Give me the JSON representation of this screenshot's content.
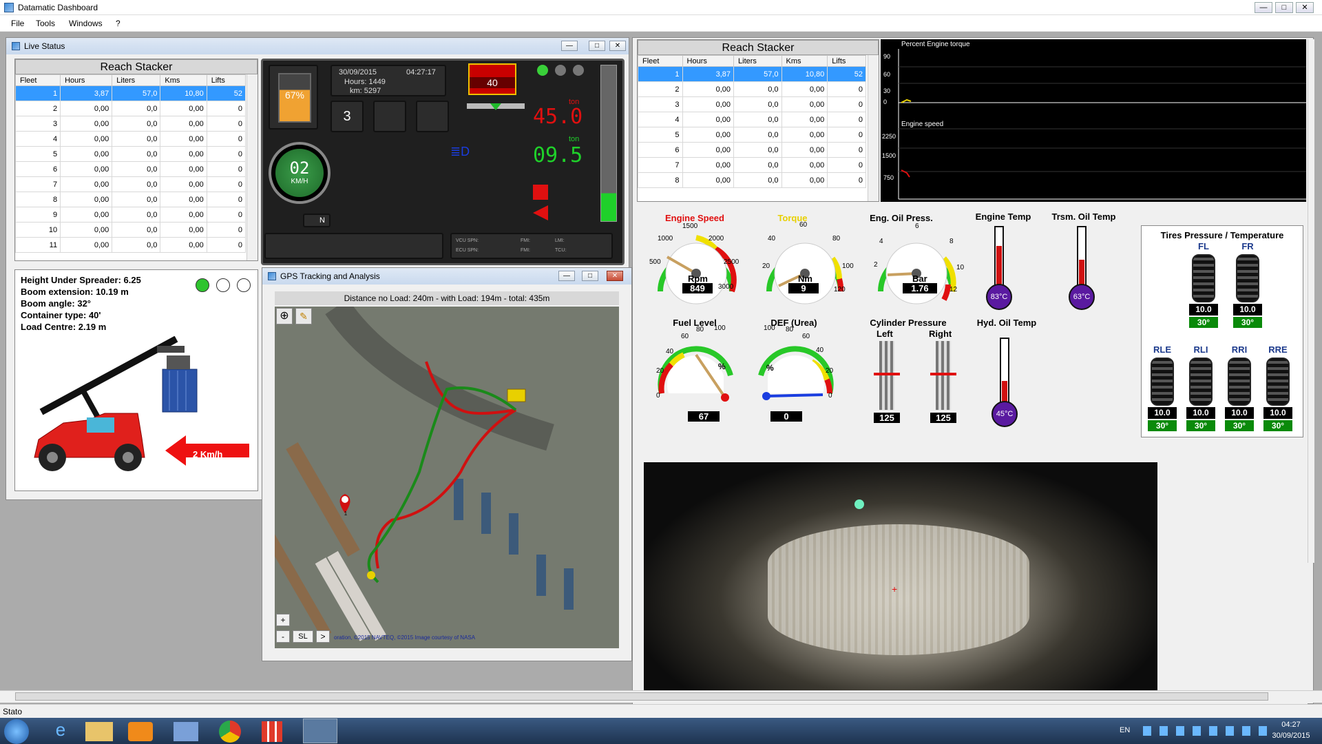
{
  "app": {
    "title": "Datamatic Dashboard",
    "min": "—",
    "max": "□",
    "close": "✕"
  },
  "menu": [
    "File",
    "Tools",
    "Windows",
    "?"
  ],
  "live_status": {
    "title": "Live Status",
    "table_title": "Reach Stacker",
    "columns": [
      "Fleet",
      "Hours",
      "Liters",
      "Kms",
      "Lifts"
    ],
    "rows": [
      [
        "1",
        "3,87",
        "57,0",
        "10,80",
        "52"
      ],
      [
        "2",
        "0,00",
        "0,0",
        "0,00",
        "0"
      ],
      [
        "3",
        "0,00",
        "0,0",
        "0,00",
        "0"
      ],
      [
        "4",
        "0,00",
        "0,0",
        "0,00",
        "0"
      ],
      [
        "5",
        "0,00",
        "0,0",
        "0,00",
        "0"
      ],
      [
        "6",
        "0,00",
        "0,0",
        "0,00",
        "0"
      ],
      [
        "7",
        "0,00",
        "0,0",
        "0,00",
        "0"
      ],
      [
        "8",
        "0,00",
        "0,0",
        "0,00",
        "0"
      ],
      [
        "9",
        "0,00",
        "0,0",
        "0,00",
        "0"
      ],
      [
        "10",
        "0,00",
        "0,0",
        "0,00",
        "0"
      ],
      [
        "11",
        "0,00",
        "0,0",
        "0,00",
        "0"
      ]
    ],
    "info": {
      "height": "Height Under Spreader:  6.25",
      "boom_ext": "Boom extension:  10.19 m",
      "boom_angle": "Boom angle:  32°",
      "container": "Container type:  40'",
      "load_centre": "Load Centre:  2.19 m"
    },
    "speed_arrow": "2 Km/h"
  },
  "console": {
    "date": "30/09/2015",
    "time": "04:27:17",
    "hours": "Hours: 1449",
    "km": "km: 5297",
    "battery": "67%",
    "gear": "3",
    "speed": "02",
    "speed_unit": "KM/H",
    "neutral": "N",
    "container_count": "40",
    "load1_unit": "ton",
    "load1": "45.0",
    "load2_unit": "ton",
    "load2": "09.5",
    "bottom1": "VCU SPN:",
    "bottom2": "ECU SPN:",
    "bottom3": "FMI:",
    "bottom4": "FMI:",
    "bottom5": "LMI:",
    "bottom6": "TCU:"
  },
  "gps": {
    "title": "GPS Tracking and Analysis",
    "distance": "Distance no Load: 240m  - with Load: 194m  - total: 435m",
    "credit": "oration, ©2015 NAVTEQ, ©2015 Image courtesy of NASA",
    "zoom_in": "+",
    "zoom_out": "-",
    "sl": "SL",
    "next": ">",
    "marker": "1"
  },
  "right_table": {
    "title": "Reach Stacker",
    "columns": [
      "Fleet",
      "Hours",
      "Liters",
      "Kms",
      "Lifts"
    ],
    "rows": [
      [
        "1",
        "3,87",
        "57,0",
        "10,80",
        "52"
      ],
      [
        "2",
        "0,00",
        "0,0",
        "0,00",
        "0"
      ],
      [
        "3",
        "0,00",
        "0,0",
        "0,00",
        "0"
      ],
      [
        "4",
        "0,00",
        "0,0",
        "0,00",
        "0"
      ],
      [
        "5",
        "0,00",
        "0,0",
        "0,00",
        "0"
      ],
      [
        "6",
        "0,00",
        "0,0",
        "0,00",
        "0"
      ],
      [
        "7",
        "0,00",
        "0,0",
        "0,00",
        "0"
      ],
      [
        "8",
        "0,00",
        "0,0",
        "0,00",
        "0"
      ]
    ]
  },
  "trend": {
    "label1": "Percent Engine torque",
    "ticks1": [
      "90",
      "60",
      "30",
      "0"
    ],
    "label2": "Engine speed",
    "ticks2": [
      "2250",
      "1500",
      "750"
    ]
  },
  "gauges": {
    "engine_speed": {
      "title": "Engine Speed",
      "unit": "Rpm",
      "value": "849",
      "ticks": [
        "500",
        "1000",
        "1500",
        "2000",
        "2500",
        "3000"
      ]
    },
    "torque": {
      "title": "Torque",
      "unit": "Nm",
      "value": "9",
      "ticks": [
        "20",
        "40",
        "60",
        "80",
        "100",
        "120"
      ]
    },
    "oil_press": {
      "title": "Eng. Oil Press.",
      "unit": "Bar",
      "value": "1.76",
      "ticks": [
        "2",
        "4",
        "6",
        "8",
        "10",
        "12"
      ]
    },
    "fuel": {
      "title": "Fuel Level",
      "unit": "%",
      "value": "67",
      "ticks": [
        "0",
        "20",
        "40",
        "60",
        "80",
        "100"
      ]
    },
    "def": {
      "title": "DEF (Urea)",
      "unit": "%",
      "value": "0",
      "ticks": [
        "100",
        "80",
        "60",
        "40",
        "20",
        "0"
      ]
    },
    "engine_temp": {
      "title": "Engine Temp",
      "value": "83°C"
    },
    "trsm_temp": {
      "title": "Trsm. Oil Temp",
      "value": "63°C"
    },
    "hyd_temp": {
      "title": "Hyd. Oil Temp",
      "value": "45°C"
    },
    "cylinder": {
      "title": "Cylinder Pressure",
      "left": "Left",
      "right": "Right",
      "left_val": "125",
      "right_val": "125"
    }
  },
  "tires": {
    "title": "Tires Pressure / Temperature",
    "front": [
      {
        "pos": "FL",
        "p": "10.0",
        "t": "30°"
      },
      {
        "pos": "FR",
        "p": "10.0",
        "t": "30°"
      }
    ],
    "rear": [
      {
        "pos": "RLE",
        "p": "10.0",
        "t": "30°"
      },
      {
        "pos": "RLI",
        "p": "10.0",
        "t": "30°"
      },
      {
        "pos": "RRI",
        "p": "10.0",
        "t": "30°"
      },
      {
        "pos": "RRE",
        "p": "10.0",
        "t": "30°"
      }
    ]
  },
  "status": {
    "text": "Stato"
  },
  "taskbar": {
    "lang": "EN",
    "time": "04:27",
    "date": "30/09/2015"
  }
}
